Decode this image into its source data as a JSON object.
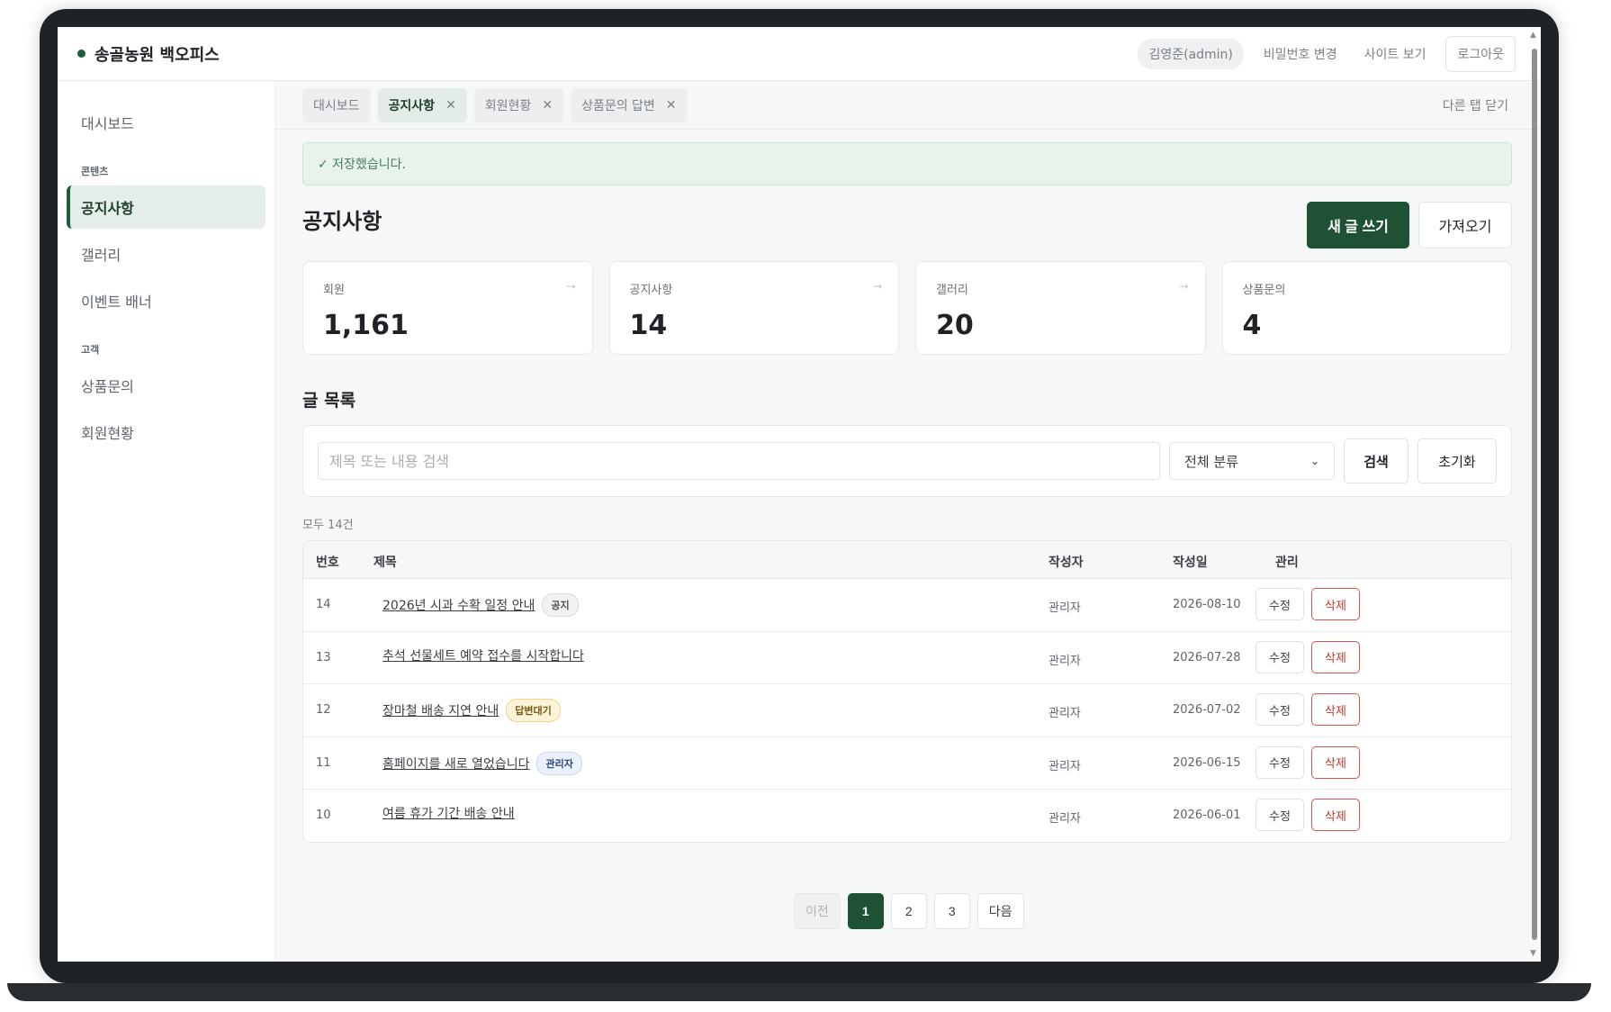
{
  "topbar": {
    "brand": "송골농원 백오피스",
    "user": "김영준(admin)",
    "change_password": "비밀번호 변경",
    "view_site": "사이트 보기",
    "logout": "로그아웃"
  },
  "sidebar": {
    "dashboard": "대시보드",
    "section_content": "콘텐츠",
    "notices": "공지사항",
    "gallery": "갤러리",
    "event_banner": "이벤트 배너",
    "section_customer": "고객",
    "product_inquiry": "상품문의",
    "members": "회원현황"
  },
  "tabs": {
    "items": [
      "대시보드",
      "공지사항",
      "회원현황",
      "상품문의 답변"
    ],
    "close_others": "다른 탭 닫기"
  },
  "alert": "✓ 저장했습니다.",
  "page": {
    "title": "공지사항",
    "new_post": "새 글 쓰기",
    "import": "가져오기"
  },
  "stats": [
    {
      "label": "회원",
      "value": "1,161"
    },
    {
      "label": "공지사항",
      "value": "14"
    },
    {
      "label": "갤러리",
      "value": "20"
    },
    {
      "label": "상품문의",
      "value": "4"
    }
  ],
  "list": {
    "section_title": "글 목록",
    "search_placeholder": "제목 또는 내용 검색",
    "category_selected": "전체 분류",
    "search_button": "검색",
    "reset_button": "초기화",
    "count": "모두 14건",
    "columns": [
      "번호",
      "제목",
      "작성자",
      "작성일",
      "관리"
    ],
    "edit_label": "수정",
    "delete_label": "삭제",
    "rows": [
      {
        "no": "14",
        "title": "2026년 시과 수확 일정 안내",
        "badge": "공지",
        "author": "관리자",
        "date": "2026-08-10"
      },
      {
        "no": "13",
        "title": "추석 선물세트 예약 접수를 시작합니다",
        "badge": "",
        "author": "관리자",
        "date": "2026-07-28"
      },
      {
        "no": "12",
        "title": "장마철 배송 지연 안내",
        "badge": "답변대기",
        "author": "관리자",
        "date": "2026-07-02"
      },
      {
        "no": "11",
        "title": "홈페이지를 새로 열었습니다",
        "badge": "관리자",
        "author": "관리자",
        "date": "2026-06-15"
      },
      {
        "no": "10",
        "title": "여름 휴가 기간 배송 안내",
        "badge": "",
        "author": "관리자",
        "date": "2026-06-01"
      }
    ]
  },
  "pagination": {
    "prev": "이전",
    "pages": [
      "1",
      "2",
      "3"
    ],
    "current": "1",
    "next": "다음"
  },
  "colors": {
    "accent": "#1f5234",
    "danger": "#c0392b",
    "success_bg": "#e8f3ec"
  }
}
